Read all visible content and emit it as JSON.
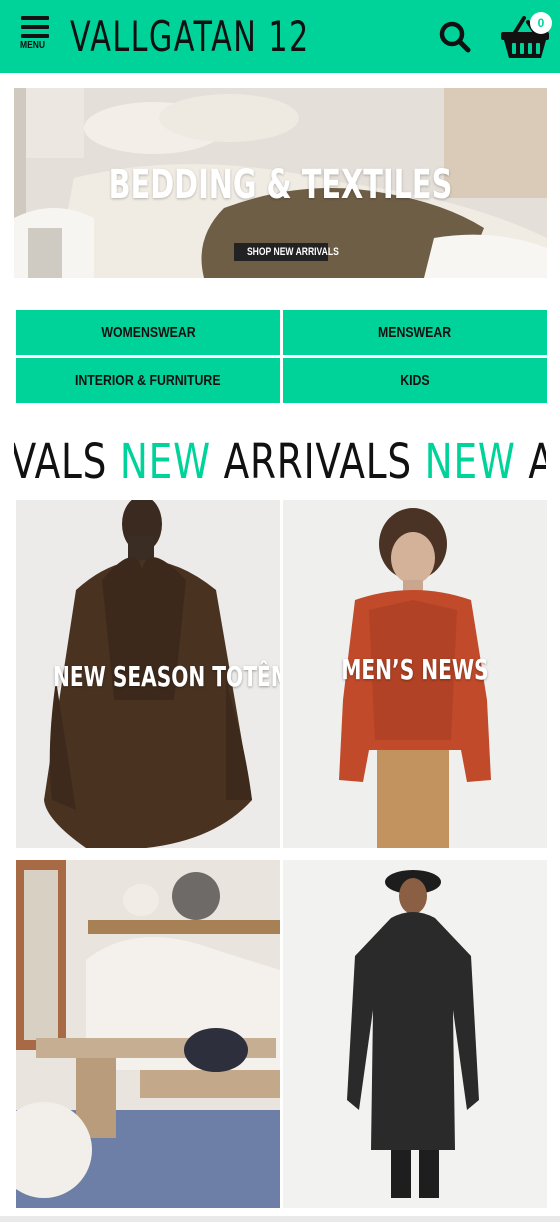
{
  "header": {
    "menu_label": "MENU",
    "logo": "VALLGATAN 12",
    "cart_count": "0",
    "icons": [
      "hamburger-icon",
      "search-icon",
      "basket-icon"
    ],
    "background": "#00d39a"
  },
  "hero": {
    "title": "BEDDING & TEXTILES",
    "cta": "SHOP NEW ARRIVALS"
  },
  "categories": [
    {
      "label": "WOMENSWEAR"
    },
    {
      "label": "MENSWEAR"
    },
    {
      "label": "INTERIOR & FURNITURE"
    },
    {
      "label": "KIDS"
    }
  ],
  "marquee": {
    "word_highlight": "NEW",
    "word_main": "ARRIVALS",
    "leading_fragment": "RIVALS",
    "trailing_fragment": "ARRI",
    "highlight_color": "#00d39a"
  },
  "tiles": [
    {
      "label": "NEW SEASON TOTÊME"
    },
    {
      "label": "MEN’S NEWS"
    },
    {
      "label": ""
    },
    {
      "label": ""
    }
  ]
}
